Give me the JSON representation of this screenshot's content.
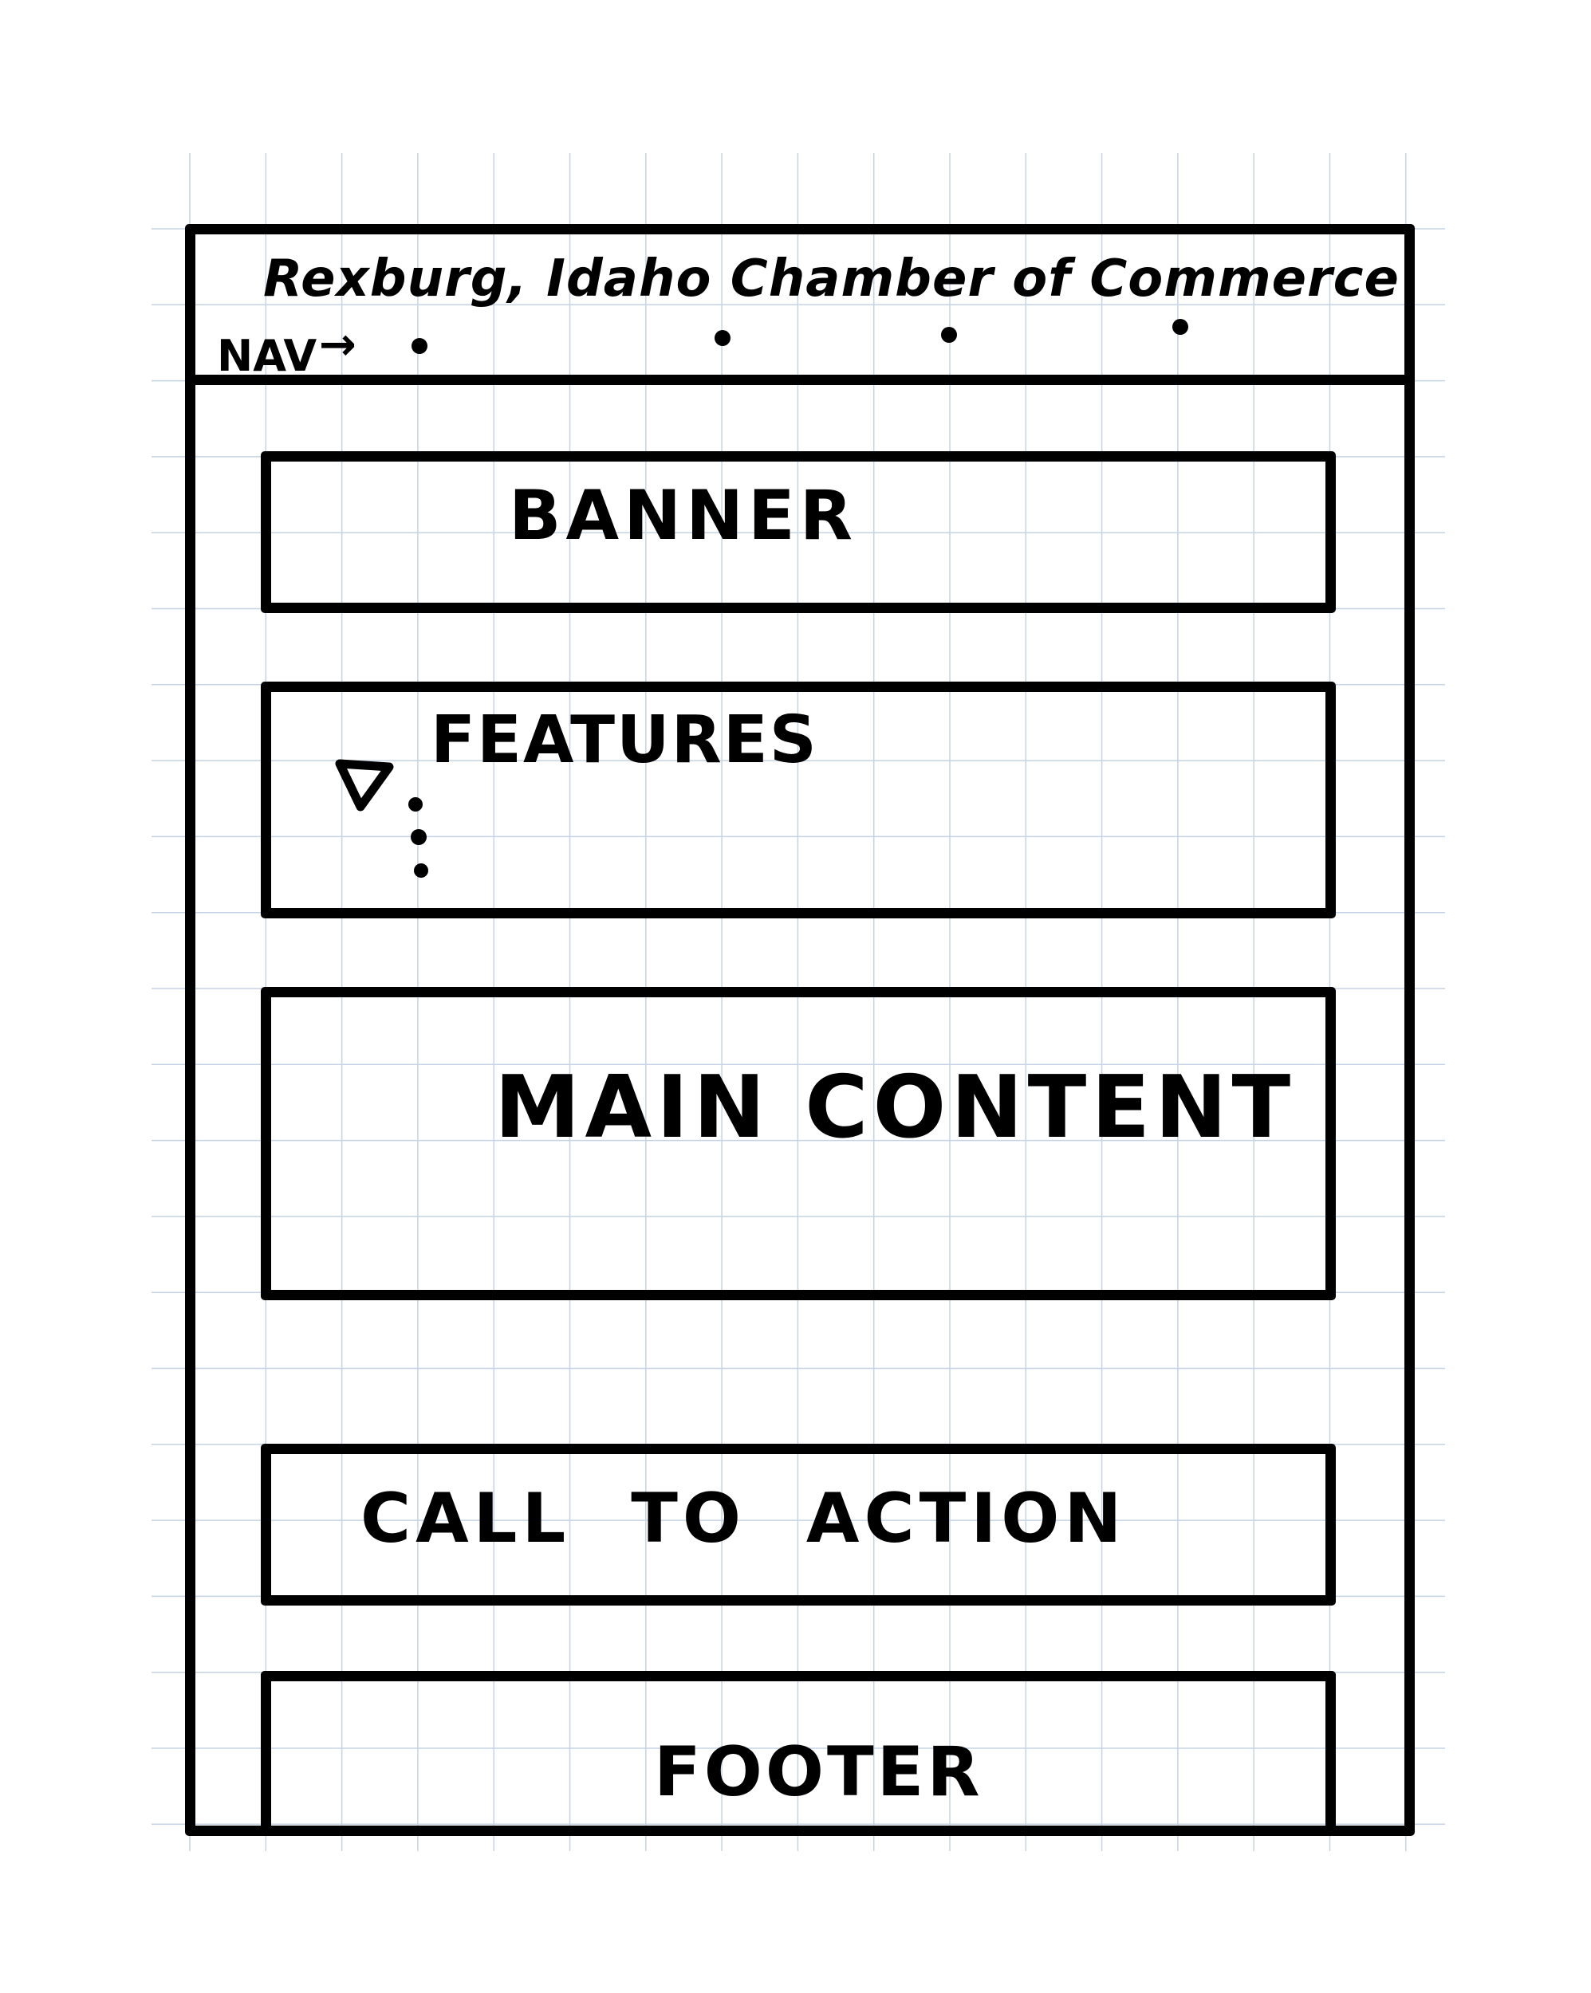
{
  "header": {
    "title": "Rexburg, Idaho Chamber of Commerce",
    "nav_label": "NAV",
    "nav_arrow": "→"
  },
  "sections": {
    "banner": "BANNER",
    "features": "FEATURES",
    "main_content": "MAIN CONTENT",
    "call_to_action": "CALL TO ACTION",
    "footer": "FOOTER"
  },
  "colors": {
    "ink": "#000000",
    "grid": "#c5d3e4",
    "paper": "#ffffff"
  }
}
